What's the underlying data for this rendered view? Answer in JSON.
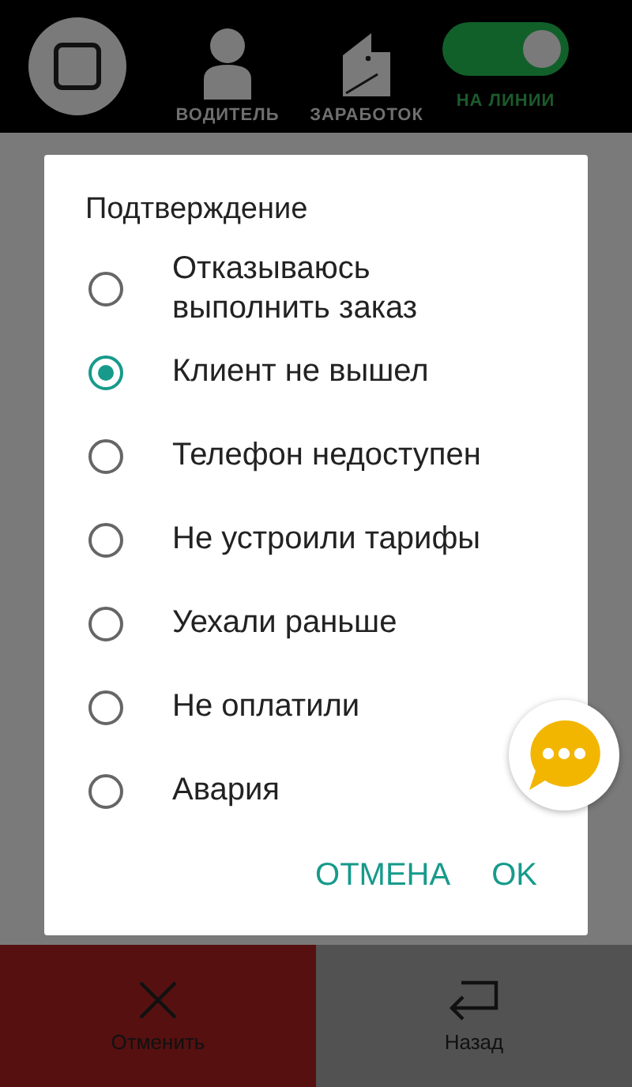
{
  "top_bar": {
    "tabs": [
      {
        "label": "ВОДИТЕЛЬ",
        "kind": "driver"
      },
      {
        "label": "ЗАРАБОТОК",
        "kind": "wallet"
      }
    ],
    "online": {
      "label": "НА ЛИНИИ",
      "on": true
    }
  },
  "dialog": {
    "title": "Подтверждение",
    "options": [
      {
        "label": "Отказываюсь выполнить заказ",
        "selected": false
      },
      {
        "label": "Клиент не вышел",
        "selected": true
      },
      {
        "label": "Телефон недоступен",
        "selected": false
      },
      {
        "label": "Не устроили тарифы",
        "selected": false
      },
      {
        "label": "Уехали раньше",
        "selected": false
      },
      {
        "label": "Не оплатили",
        "selected": false
      },
      {
        "label": "Авария",
        "selected": false
      }
    ],
    "buttons": [
      "ОТМЕНА",
      "OK"
    ]
  },
  "bottom_bar": [
    {
      "label": "Отменить",
      "kind": "cancel"
    },
    {
      "label": "Назад",
      "kind": "back"
    }
  ]
}
